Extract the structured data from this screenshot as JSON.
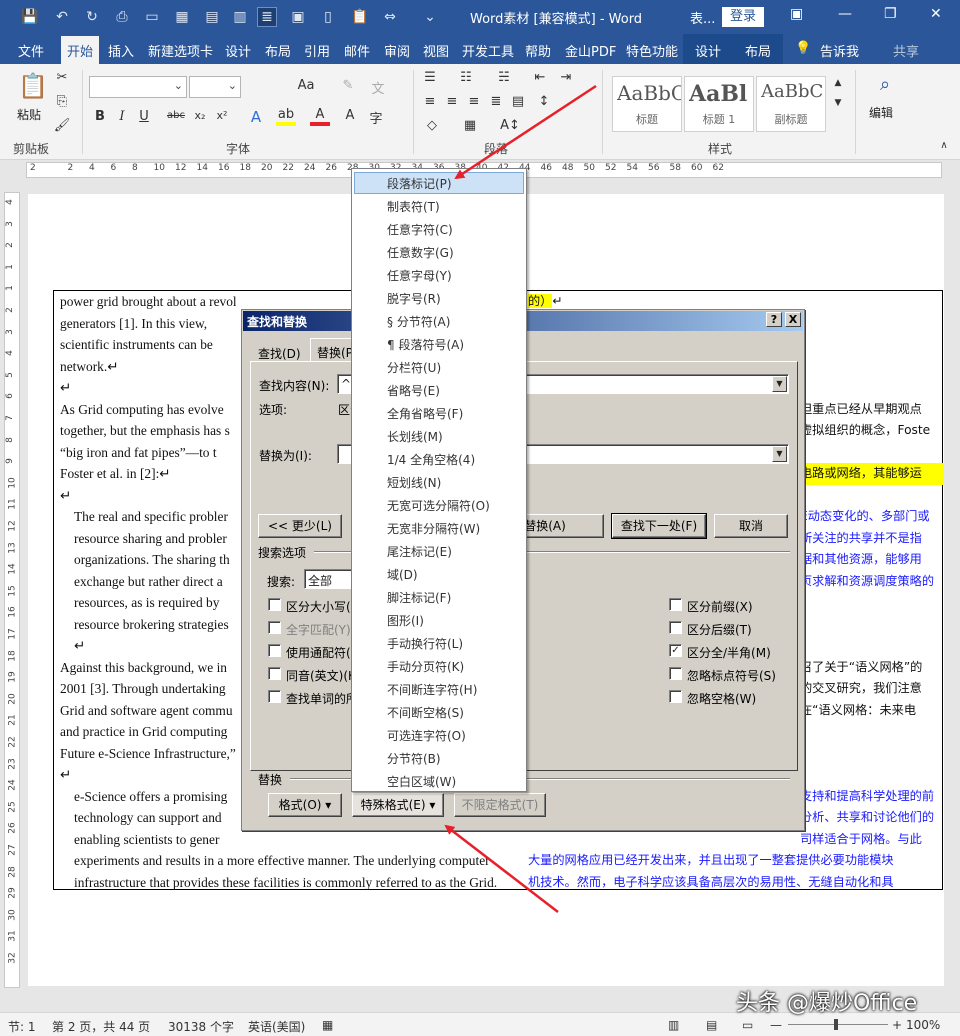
{
  "titlebar": {
    "title": "Word素材 [兼容模式] - Word",
    "context_tab": "表...",
    "login": "登录",
    "minimize": "—",
    "restore": "❐",
    "close": "✕"
  },
  "tabs": [
    "文件",
    "开始",
    "插入",
    "新建选项卡",
    "设计",
    "布局",
    "引用",
    "邮件",
    "审阅",
    "视图",
    "开发工具",
    "帮助",
    "金山PDF",
    "特色功能",
    "设计",
    "布局",
    "告诉我",
    "共享"
  ],
  "ribbon": {
    "groups": {
      "clipboard": "剪贴板",
      "font": "字体",
      "paragraph": "段落",
      "styles": "样式"
    },
    "paste": "粘贴",
    "edit": "编辑",
    "font_btns": {
      "bold": "B",
      "italic": "I",
      "underline": "U",
      "strike": "abc",
      "sub": "x₂",
      "sup": "x²",
      "case": "Aa",
      "clear": "A"
    },
    "styles": [
      {
        "sample": "AaBbC",
        "name": "标题"
      },
      {
        "sample": "AaBl",
        "name": "标题 1"
      },
      {
        "sample": "AaBbC",
        "name": "副标题"
      }
    ]
  },
  "ruler": {
    "h": [
      "2",
      "2",
      "4",
      "6",
      "8",
      "10",
      "12",
      "14",
      "16",
      "18",
      "20",
      "22",
      "24",
      "26",
      "28",
      "30",
      "32",
      "34",
      "36",
      "38",
      "40",
      "42",
      "44",
      "46",
      "48",
      "50",
      "52",
      "54",
      "56",
      "58",
      "60",
      "62"
    ],
    "v": [
      "4",
      "3",
      "2",
      "1",
      "1",
      "2",
      "3",
      "4",
      "5",
      "6",
      "7",
      "8",
      "9",
      "10",
      "11",
      "12",
      "13",
      "14",
      "15",
      "16",
      "17",
      "18",
      "19",
      "20",
      "21",
      "22",
      "23",
      "24",
      "25",
      "26",
      "27",
      "28",
      "29",
      "30",
      "31",
      "32"
    ]
  },
  "doc_left": [
    {
      "text": "power grid brought about a revolutionary change fro",
      "indent": 0
    },
    {
      "text": "generators [1]. In this view,",
      "indent": 0
    },
    {
      "text": "scientific instruments can be",
      "indent": 0
    },
    {
      "text": "network.↵",
      "indent": 0
    },
    {
      "text": "↵",
      "indent": 0
    },
    {
      "text": "As Grid computing has evolve",
      "indent": 0
    },
    {
      "text": "together, but the emphasis has s",
      "indent": 0
    },
    {
      "text": "“big iron and fat pipes”—to t",
      "indent": 0
    },
    {
      "text": "Foster et al. in [2]:↵",
      "indent": 0
    },
    {
      "text": "↵",
      "indent": 0
    },
    {
      "text": "The real and specific probler",
      "indent": 1
    },
    {
      "text": "resource sharing and probler",
      "indent": 1
    },
    {
      "text": "organizations. The sharing th",
      "indent": 1
    },
    {
      "text": "exchange but rather direct a",
      "indent": 1
    },
    {
      "text": "resources, as is required by",
      "indent": 1
    },
    {
      "text": "resource brokering strategies",
      "indent": 1
    },
    {
      "text": "↵",
      "indent": 1
    },
    {
      "text": "Against this background, we in",
      "indent": 0
    },
    {
      "text": "2001 [3]. Through undertaking",
      "indent": 0
    },
    {
      "text": "Grid and software agent commu",
      "indent": 0
    },
    {
      "text": "and practice in Grid computing",
      "indent": 0
    },
    {
      "text": "Future e-Science Infrastructure,”",
      "indent": 0
    },
    {
      "text": "↵",
      "indent": 0
    },
    {
      "text": "e-Science offers a promising",
      "indent": 1
    },
    {
      "text": "technology can support and",
      "indent": 1
    },
    {
      "text": "enabling scientists to gener",
      "indent": 1
    },
    {
      "text": "experiments and results in a more effective manner. The underlying computer",
      "indent": 1
    },
    {
      "text": "infrastructure that provides these facilities is commonly referred to as the Grid.",
      "indent": 1
    }
  ],
  "doc_right": [
    {
      "text": "的）↵",
      "row": 0,
      "style": "hl-top"
    },
    {
      "text": "但重点已经从早期观点",
      "row": 5,
      "style": ""
    },
    {
      "text": "虚拟组织的概念，Foste",
      "row": 6,
      "style": ""
    },
    {
      "text": "电路或网络，其能够运",
      "row": 8,
      "style": "hl"
    },
    {
      "text": "E动态变化的、多部门或",
      "row": 10,
      "style": "blue"
    },
    {
      "text": "所关注的共享并不是指",
      "row": 11,
      "style": "blue"
    },
    {
      "text": "据和其他资源，能够用",
      "row": 12,
      "style": "blue"
    },
    {
      "text": "页求解和资源调度策略的",
      "row": 13,
      "style": "blue"
    },
    {
      "text": "召了关于“语义网格”的",
      "row": 17,
      "style": ""
    },
    {
      "text": "的交叉研究，我们注意",
      "row": 18,
      "style": ""
    },
    {
      "text": "在“语义网格：未来电",
      "row": 19,
      "style": ""
    },
    {
      "text": "支持和提高科学处理的前",
      "row": 23,
      "style": "blue"
    },
    {
      "text": "分析、共享和讨论他们的",
      "row": 24,
      "style": "blue"
    },
    {
      "text": "司样适合于网格。与此",
      "row": 25,
      "style": "blue"
    },
    {
      "text": "大量的网格应用已经开发出来，并且出现了一整套提供必要功能模块",
      "row": 26,
      "style": "blue"
    },
    {
      "text": "机技术。然而，电子科学应该具备高层次的易用性、无缝自动化和具",
      "row": 27,
      "style": "blue"
    }
  ],
  "dialog": {
    "title": "查找和替换",
    "help": "?",
    "close": "X",
    "tabs": [
      "查找(D)",
      "替换(P)"
    ],
    "find_label": "查找内容(N):",
    "find_value": "^v",
    "options_label": "选项:",
    "options_value": "区分",
    "replace_label": "替换为(I):",
    "replace_value": "",
    "less_btn": "<< 更少(L)",
    "replace_all_btn": "部替换(A)",
    "find_next_btn": "查找下一处(F)",
    "cancel_btn": "取消",
    "search_options": "搜索选项",
    "search_label": "搜索:",
    "search_value": "全部",
    "checks_left": [
      {
        "label": "区分大小写(",
        "checked": false,
        "disabled": false
      },
      {
        "label": "全字匹配(Y)",
        "checked": false,
        "disabled": true
      },
      {
        "label": "使用通配符(",
        "checked": false,
        "disabled": false
      },
      {
        "label": "同音(英文)(K",
        "checked": false,
        "disabled": false
      },
      {
        "label": "查找单词的所",
        "checked": false,
        "disabled": false
      }
    ],
    "checks_right": [
      {
        "label": "区分前缀(X)",
        "checked": false
      },
      {
        "label": "区分后缀(T)",
        "checked": false
      },
      {
        "label": "区分全/半角(M)",
        "checked": true
      },
      {
        "label": "忽略标点符号(S)",
        "checked": false
      },
      {
        "label": "忽略空格(W)",
        "checked": false
      }
    ],
    "replace_section": "替换",
    "format_btn": "格式(O) ▾",
    "special_btn": "特殊格式(E) ▾",
    "noformat_btn": "不限定格式(T)"
  },
  "menu": {
    "items": [
      "段落标记(P)",
      "制表符(T)",
      "任意字符(C)",
      "任意数字(G)",
      "任意字母(Y)",
      "脱字号(R)",
      "§ 分节符(A)",
      "¶ 段落符号(A)",
      "分栏符(U)",
      "省略号(E)",
      "全角省略号(F)",
      "长划线(M)",
      "1/4 全角空格(4)",
      "短划线(N)",
      "无宽可选分隔符(O)",
      "无宽非分隔符(W)",
      "尾注标记(E)",
      "域(D)",
      "脚注标记(F)",
      "图形(I)",
      "手动换行符(L)",
      "手动分页符(K)",
      "不间断连字符(H)",
      "不间断空格(S)",
      "可选连字符(O)",
      "分节符(B)",
      "空白区域(W)"
    ],
    "selected": 0
  },
  "status": {
    "section": "节: 1",
    "page": "第 2 页，共 44 页",
    "words": "30138 个字",
    "lang": "英语(美国)",
    "zoom": "100%",
    "minus": "—",
    "plus": "+"
  },
  "watermark": "头条 @爆炒Office",
  "colors": {
    "brand": "#2b579a",
    "arrow": "#e8202a",
    "highlight": "#ffff00",
    "link_blue": "#1a1aff"
  }
}
